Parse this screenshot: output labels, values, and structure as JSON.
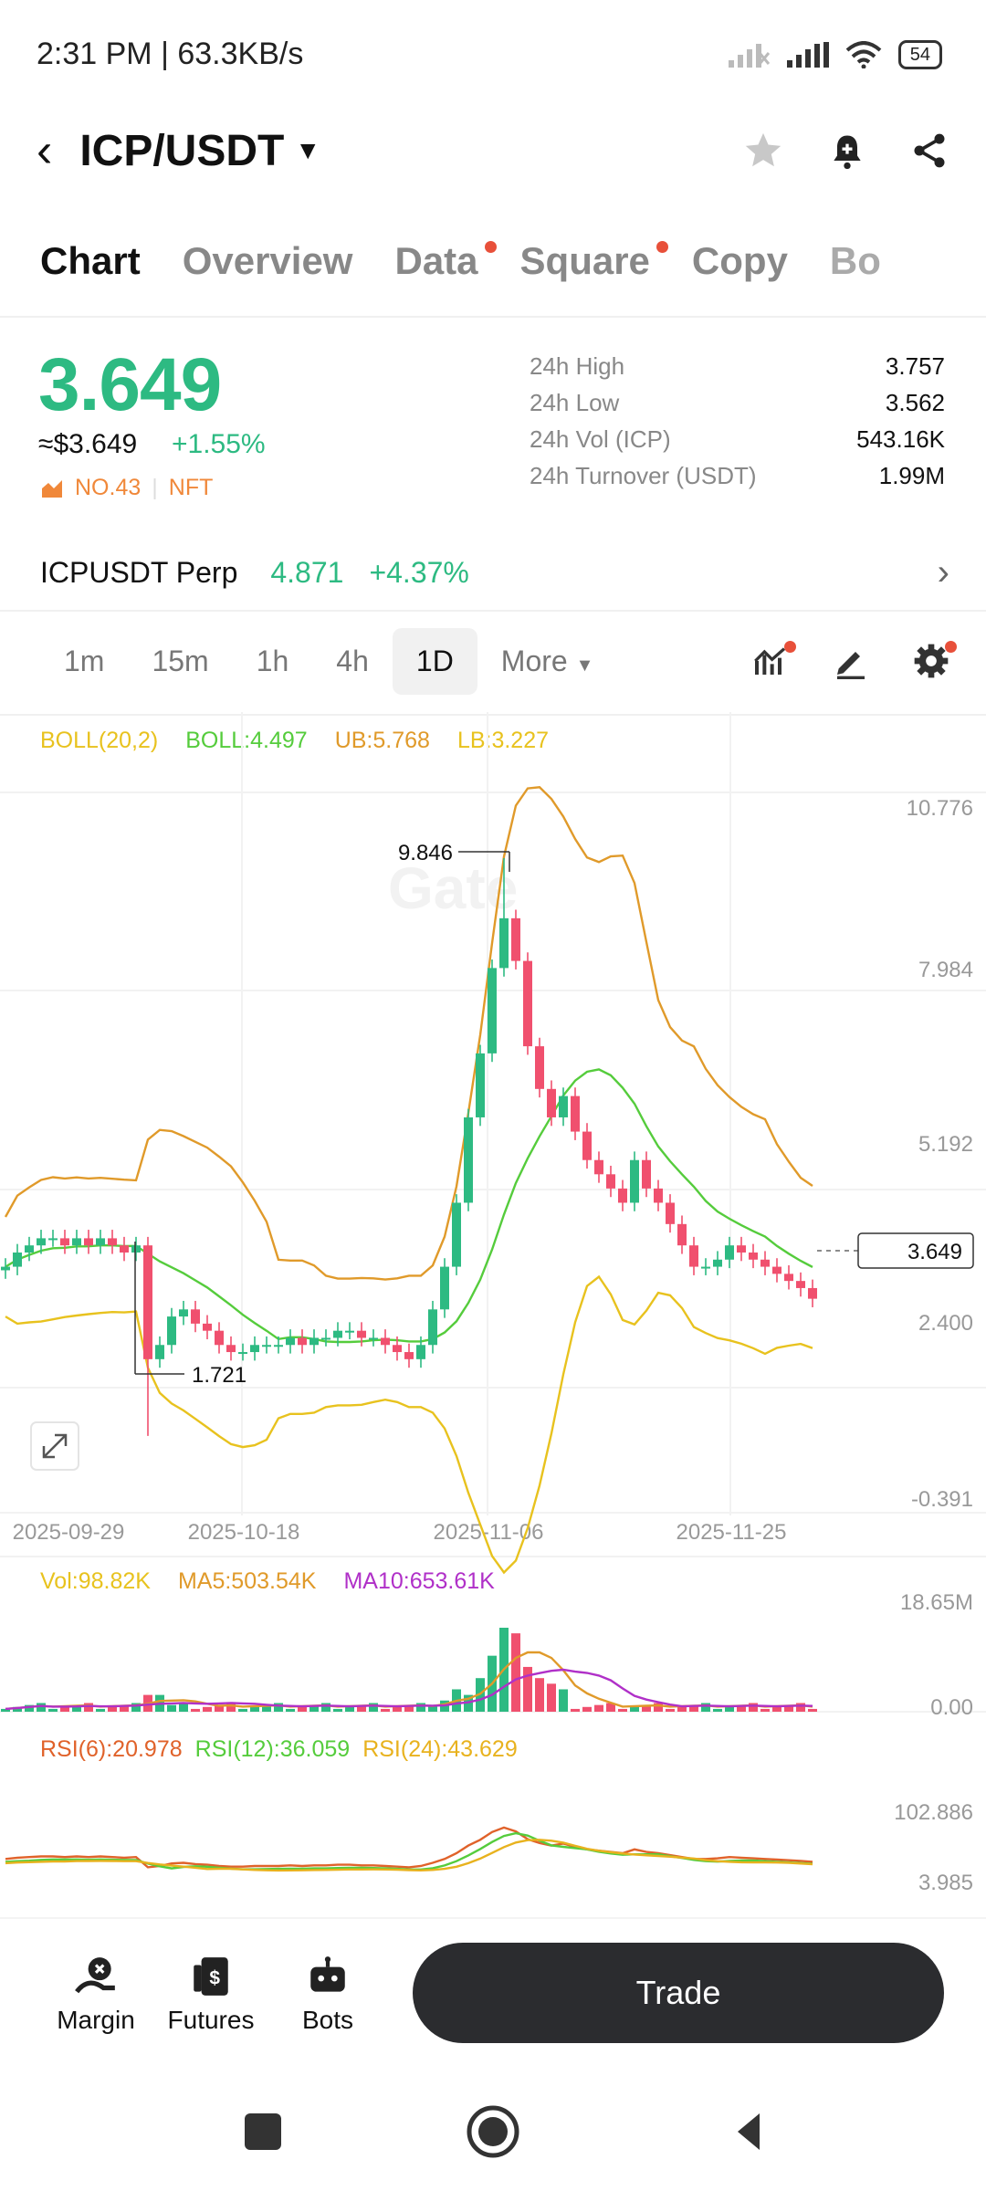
{
  "status": {
    "time_speed": "2:31 PM | 63.3KB/s",
    "battery": "54"
  },
  "header": {
    "pair": "ICP/USDT"
  },
  "tabs": [
    {
      "label": "Chart",
      "active": true,
      "dot": false
    },
    {
      "label": "Overview",
      "active": false,
      "dot": false
    },
    {
      "label": "Data",
      "active": false,
      "dot": true
    },
    {
      "label": "Square",
      "active": false,
      "dot": true
    },
    {
      "label": "Copy",
      "active": false,
      "dot": false
    },
    {
      "label": "Bo",
      "active": false,
      "dot": false
    }
  ],
  "price": {
    "last": "3.649",
    "usd": "≈$3.649",
    "change": "+1.55%",
    "rank": "NO.43",
    "tag": "NFT"
  },
  "stats": [
    {
      "label": "24h High",
      "value": "3.757"
    },
    {
      "label": "24h Low",
      "value": "3.562"
    },
    {
      "label": "24h Vol (ICP)",
      "value": "543.16K"
    },
    {
      "label": "24h Turnover (USDT)",
      "value": "1.99M"
    }
  ],
  "perp": {
    "name": "ICPUSDT Perp",
    "price": "4.871",
    "change": "+4.37%"
  },
  "intervals": [
    "1m",
    "15m",
    "1h",
    "4h",
    "1D",
    "More"
  ],
  "indicators": {
    "boll": [
      "BOLL(20,2)",
      "BOLL:4.497",
      "UB:5.768",
      "LB:3.227"
    ],
    "vol": [
      "Vol:98.82K",
      "MA5:503.54K",
      "MA10:653.61K"
    ],
    "rsi": [
      "RSI(6):20.978",
      "RSI(12):36.059",
      "RSI(24):43.629"
    ]
  },
  "chart_data": {
    "type": "candlestick",
    "price_axis_ticks": [
      "10.776",
      "7.984",
      "5.192",
      "2.400",
      "-0.391"
    ],
    "date_ticks": [
      "2025-09-29",
      "2025-10-18",
      "2025-11-06",
      "2025-11-25"
    ],
    "last_price_label": "3.649",
    "max_label": "9.846",
    "min_label": "1.721",
    "volume_axis_ticks": [
      "18.65M",
      "0.00"
    ],
    "rsi_axis_ticks": [
      "102.886",
      "3.985"
    ],
    "candles_close": [
      4.1,
      4.3,
      4.4,
      4.5,
      4.5,
      4.4,
      4.5,
      4.4,
      4.5,
      4.4,
      4.3,
      4.4,
      2.8,
      3.0,
      3.4,
      3.5,
      3.3,
      3.2,
      3.0,
      2.9,
      2.9,
      3.0,
      3.0,
      3.0,
      3.1,
      3.0,
      3.1,
      3.1,
      3.2,
      3.2,
      3.1,
      3.1,
      3.0,
      2.9,
      2.8,
      3.0,
      3.5,
      4.1,
      5.0,
      6.2,
      7.1,
      8.3,
      9.0,
      8.4,
      7.2,
      6.6,
      6.2,
      6.5,
      6.0,
      5.6,
      5.4,
      5.2,
      5.0,
      5.6,
      5.2,
      5.0,
      4.7,
      4.4,
      4.1,
      4.1,
      4.2,
      4.4,
      4.3,
      4.2,
      4.1,
      4.0,
      3.9,
      3.8,
      3.65
    ],
    "colors": {
      "up": "#2dba82",
      "down": "#f0506e",
      "boll_mid": "#55cc3c",
      "boll_ub": "#e09a2a",
      "boll_lb": "#e8c21e",
      "ma10": "#b030c8"
    }
  },
  "bottom_nav": [
    {
      "label": "Margin"
    },
    {
      "label": "Futures"
    },
    {
      "label": "Bots"
    }
  ],
  "trade_label": "Trade"
}
